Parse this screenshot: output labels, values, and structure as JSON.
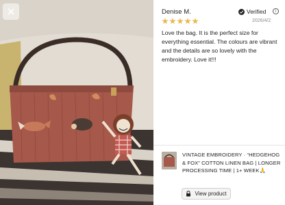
{
  "review": {
    "reviewer_name": "Denise M.",
    "verified_label": "Verified",
    "rating": 5,
    "date": "2026/4/2",
    "text": "Love the bag. It is the perfect size for everything essential. The colours are vibrant and the details are so lovely with the embroidery. Love it!!!"
  },
  "product": {
    "title": "VINTAGE EMBROIDERY · “HEDGEHOG & FOX” COTTON LINEN BAG | LONGER PROCESSING TIME | 1+ WEEK🙏",
    "view_label": "View product"
  },
  "colors": {
    "star": "#e6b94a",
    "bag": "#a6584a",
    "background": "#ffffff"
  },
  "icons": [
    "close-icon",
    "verified-icon",
    "info-icon",
    "star-icon",
    "lock-icon"
  ]
}
